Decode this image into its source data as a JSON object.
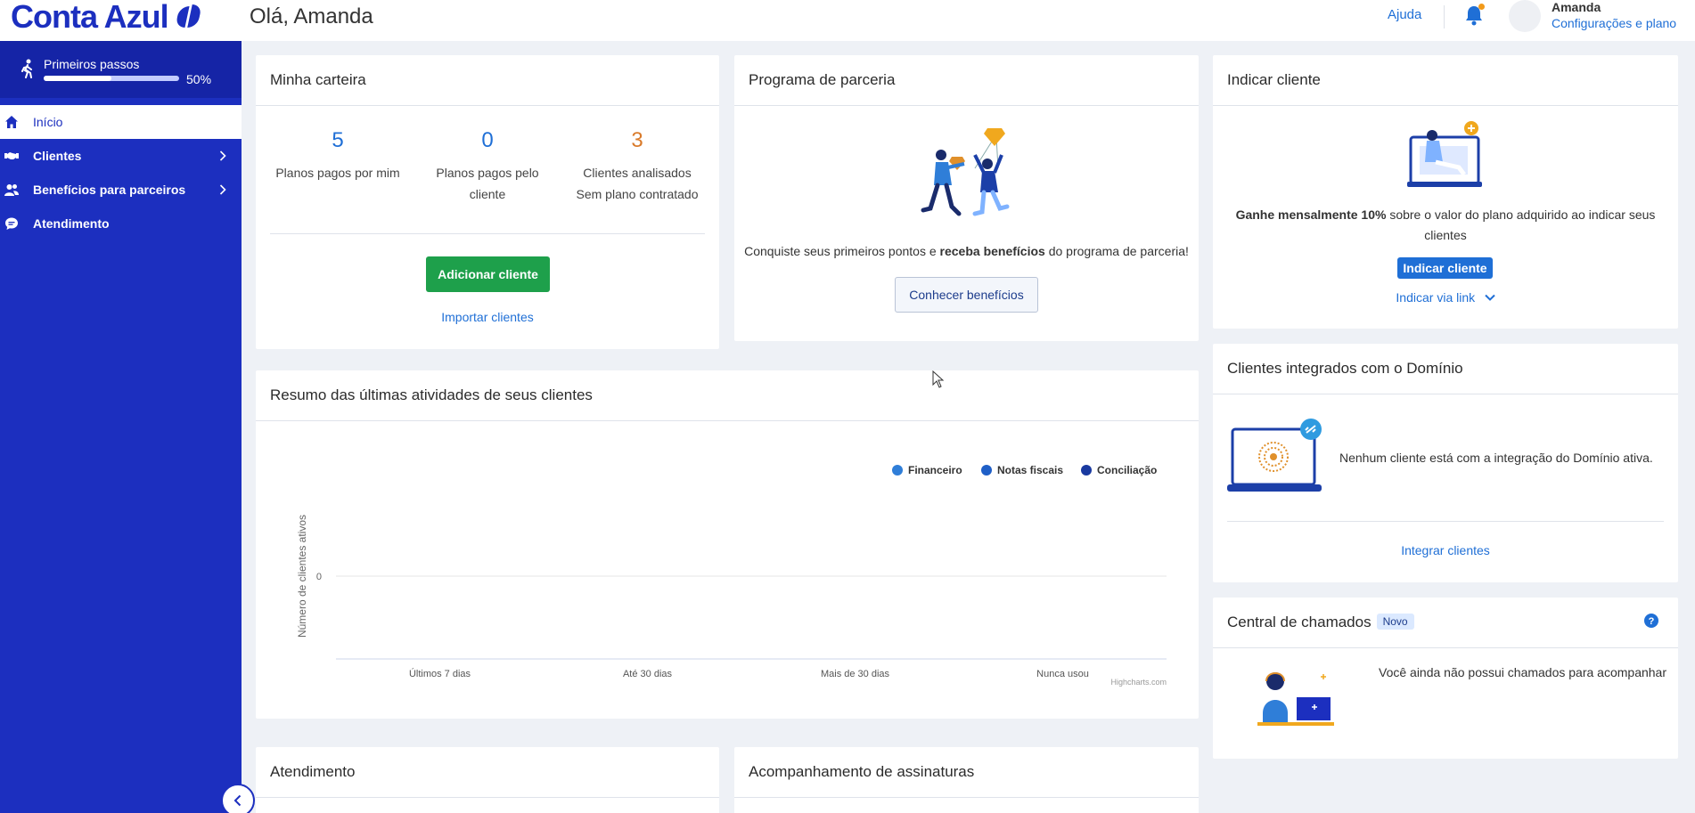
{
  "brand": {
    "name": "Conta Azul"
  },
  "header": {
    "greeting": "Olá, Amanda",
    "help": "Ajuda",
    "user_name": "Amanda",
    "user_config": "Configurações e plano",
    "bell_icon": "bell-icon"
  },
  "sidebar": {
    "steps_title": "Primeiros passos",
    "steps_progress": "50%",
    "steps_progress_value": 50,
    "items": [
      {
        "label": "Início",
        "icon": "home-icon",
        "active": true
      },
      {
        "label": "Clientes",
        "icon": "handshake-icon",
        "chevron": true
      },
      {
        "label": "Benefícios para parceiros",
        "icon": "users-icon",
        "chevron": true
      },
      {
        "label": "Atendimento",
        "icon": "chat-icon"
      }
    ]
  },
  "carteira": {
    "title": "Minha carteira",
    "stats": [
      {
        "value": "5",
        "label_1": "Planos pagos por mim",
        "label_2": "",
        "color": "#1f6fd6"
      },
      {
        "value": "0",
        "label_1": "Planos pagos pelo",
        "label_2": "cliente",
        "color": "#1f6fd6"
      },
      {
        "value": "3",
        "label_1": "Clientes analisados",
        "label_2": "Sem plano contratado",
        "color": "#d97a2a"
      }
    ],
    "add_button": "Adicionar cliente",
    "import_link": "Importar clientes"
  },
  "parceria": {
    "title": "Programa de parceria",
    "text_before": "Conquiste seus primeiros pontos e ",
    "text_bold": "receba benefícios",
    "text_after": " do programa de parceria!",
    "button": "Conhecer benefícios"
  },
  "indicar": {
    "title": "Indicar cliente",
    "text_bold": "Ganhe mensalmente 10%",
    "text_rest": " sobre o valor do plano adquirido ao indicar seus",
    "text_line2": "clientes",
    "button": "Indicar cliente",
    "link": "Indicar via link"
  },
  "resumo": {
    "title": "Resumo das últimas atividades de seus clientes",
    "credit": "Highcharts.com"
  },
  "chart_data": {
    "type": "bar",
    "categories": [
      "Últimos 7 dias",
      "Até 30 dias",
      "Mais de 30 dias",
      "Nunca usou"
    ],
    "series": [
      {
        "name": "Financeiro",
        "color": "#2f7ed8",
        "values": [
          0,
          0,
          0,
          0
        ]
      },
      {
        "name": "Notas fiscais",
        "color": "#1f5fc7",
        "values": [
          0,
          0,
          0,
          0
        ]
      },
      {
        "name": "Conciliação",
        "color": "#1a3aa0",
        "values": [
          0,
          0,
          0,
          0
        ]
      }
    ],
    "ylabel": "Número de clientes ativos",
    "yticks": [
      "0"
    ],
    "legend_position": "top-right"
  },
  "dominio": {
    "title": "Clientes integrados com o Domínio",
    "text": "Nenhum cliente está com a integração do Domínio ativa.",
    "link": "Integrar clientes"
  },
  "chamados": {
    "title": "Central de chamados",
    "badge": "Novo",
    "text": "Você ainda não possui chamados para acompanhar"
  },
  "atendimento": {
    "title": "Atendimento"
  },
  "assinaturas": {
    "title": "Acompanhamento de assinaturas"
  }
}
